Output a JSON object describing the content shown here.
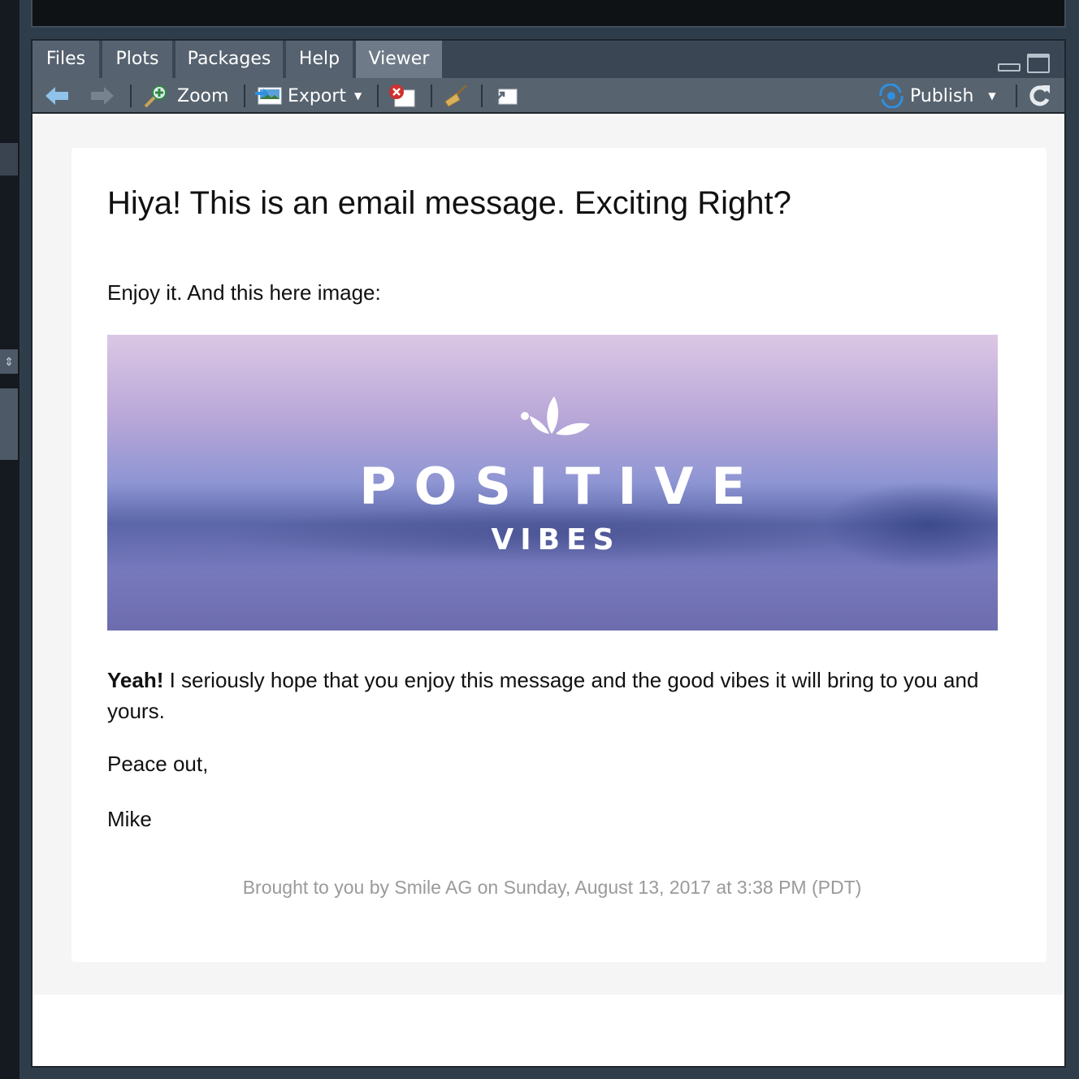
{
  "tabs": [
    "Files",
    "Plots",
    "Packages",
    "Help",
    "Viewer"
  ],
  "active_tab": "Viewer",
  "toolbar": {
    "zoom_label": "Zoom",
    "export_label": "Export",
    "publish_label": "Publish"
  },
  "email": {
    "heading": "Hiya! This is an email message. Exciting Right?",
    "intro": "Enjoy it. And this here image:",
    "image": {
      "title": "POSITIVE",
      "subtitle": "VIBES"
    },
    "body_bold": "Yeah!",
    "body_text": " I seriously hope that you enjoy this message and the good vibes it will bring to you and yours.",
    "signoff": "Peace out,",
    "signature": "Mike",
    "footer": "Brought to you by Smile AG on Sunday, August 13, 2017 at 3:38 PM (PDT)"
  },
  "colors": {
    "accent_publish": "#2f8fe0",
    "tab_active": "#6e7a87",
    "footer_text": "#9a9a9a"
  }
}
